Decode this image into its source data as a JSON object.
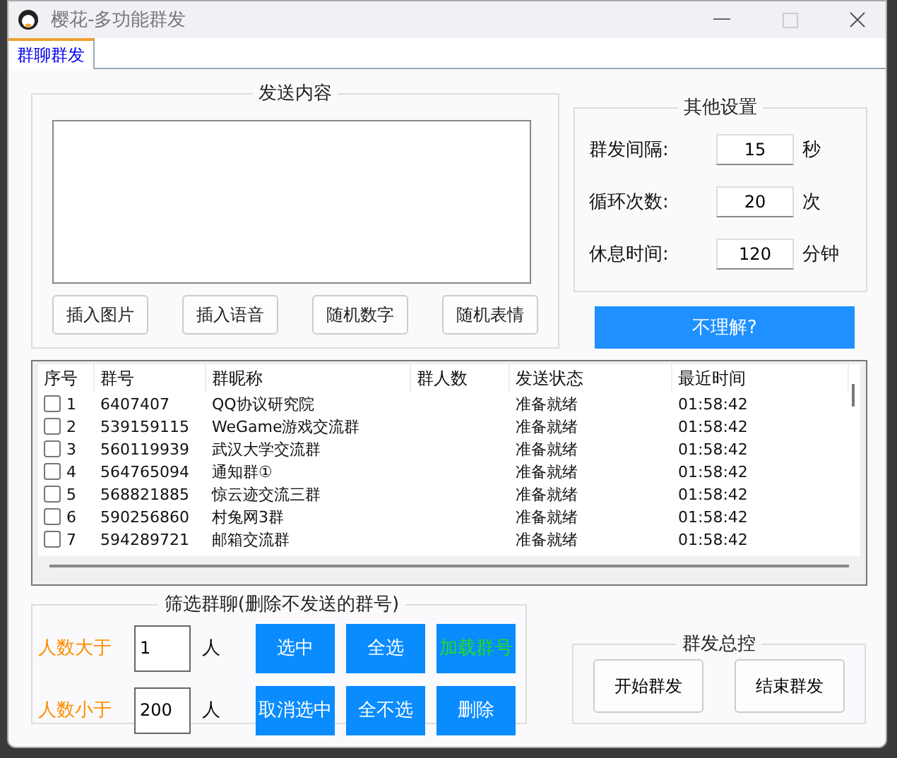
{
  "window": {
    "title": "樱花-多功能群发"
  },
  "tabs": [
    {
      "label": "群聊群发",
      "selected": true
    }
  ],
  "send_content": {
    "title": "发送内容",
    "buttons": [
      "插入图片",
      "插入语音",
      "随机数字",
      "随机表情"
    ]
  },
  "other_settings": {
    "title": "其他设置",
    "rows": [
      {
        "label": "群发间隔:",
        "value": "15",
        "unit": "秒"
      },
      {
        "label": "循环次数:",
        "value": "20",
        "unit": "次"
      },
      {
        "label": "休息时间:",
        "value": "120",
        "unit": "分钟"
      }
    ]
  },
  "help_button": "不理解?",
  "table": {
    "columns": [
      "序号",
      "群号",
      "群昵称",
      "群人数",
      "发送状态",
      "最近时间"
    ],
    "rows": [
      {
        "index": "1",
        "id": "6407407",
        "name": "QQ协议研究院",
        "status": "准备就绪",
        "time": "01:58:42",
        "checked": false
      },
      {
        "index": "2",
        "id": "539159115",
        "name": "WeGame游戏交流群",
        "status": "准备就绪",
        "time": "01:58:42",
        "checked": false
      },
      {
        "index": "3",
        "id": "560119939",
        "name": "武汉大学交流群",
        "status": "准备就绪",
        "time": "01:58:42",
        "checked": false
      },
      {
        "index": "4",
        "id": "564765094",
        "name": "通知群①",
        "status": "准备就绪",
        "time": "01:58:42",
        "checked": false
      },
      {
        "index": "5",
        "id": "568821885",
        "name": "惊云迹交流三群",
        "status": "准备就绪",
        "time": "01:58:42",
        "checked": false
      },
      {
        "index": "6",
        "id": "590256860",
        "name": "村兔网3群",
        "status": "准备就绪",
        "time": "01:58:42",
        "checked": false
      },
      {
        "index": "7",
        "id": "594289721",
        "name": "邮箱交流群",
        "status": "准备就绪",
        "time": "01:58:42",
        "checked": false
      }
    ]
  },
  "filter": {
    "title": "筛选群聊(删除不发送的群号)",
    "rows": [
      {
        "label": "人数大于",
        "value": "1",
        "unit": "人"
      },
      {
        "label": "人数小于",
        "value": "200",
        "unit": "人"
      }
    ],
    "buttons": [
      {
        "label": "选中",
        "kind": "normal"
      },
      {
        "label": "全选",
        "kind": "normal"
      },
      {
        "label": "加载群号",
        "kind": "highlight"
      },
      {
        "label": "取消选中",
        "kind": "normal"
      },
      {
        "label": "全不选",
        "kind": "normal"
      },
      {
        "label": "删除",
        "kind": "normal"
      }
    ]
  },
  "control": {
    "title": "群发总控",
    "buttons": [
      "开始群发",
      "结束群发"
    ]
  }
}
